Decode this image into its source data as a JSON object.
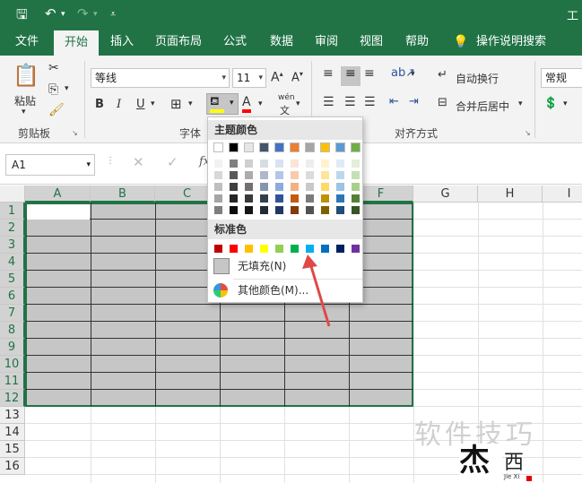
{
  "titlebar": {
    "title": "工"
  },
  "tabs": [
    "文件",
    "开始",
    "插入",
    "页面布局",
    "公式",
    "数据",
    "审阅",
    "视图",
    "帮助",
    "操作说明搜索"
  ],
  "ribbon": {
    "paste_label": "粘贴",
    "clipboard_group": "剪贴板",
    "font_name": "等线",
    "font_size": "11",
    "font_group": "字体",
    "bold": "B",
    "italic": "I",
    "underline": "U",
    "wen": "wén",
    "wrap_text": "自动换行",
    "merge_center": "合并后居中",
    "align_group": "对齐方式",
    "number_format": "常规"
  },
  "formula_bar": {
    "name_box": "A1",
    "fx": "fx"
  },
  "grid": {
    "columns": [
      "A",
      "B",
      "C",
      "D",
      "E",
      "F",
      "G",
      "H",
      "I"
    ],
    "rows": [
      "1",
      "2",
      "3",
      "4",
      "5",
      "6",
      "7",
      "8",
      "9",
      "10",
      "11",
      "12",
      "13",
      "14",
      "15",
      "16"
    ]
  },
  "dropdown": {
    "theme_colors_label": "主题颜色",
    "standard_colors_label": "标准色",
    "no_fill": "无填充(N)",
    "more_colors": "其他颜色(M)...",
    "theme_top": [
      "#ffffff",
      "#000000",
      "#e7e6e6",
      "#44546a",
      "#4472c4",
      "#ed7d31",
      "#a5a5a5",
      "#ffc000",
      "#5b9bd5",
      "#70ad47"
    ],
    "theme_shades": [
      [
        "#f2f2f2",
        "#7f7f7f",
        "#d0cece",
        "#d6dce4",
        "#d9e2f3",
        "#fbe5d5",
        "#ededed",
        "#fff2cc",
        "#deebf6",
        "#e2efd9"
      ],
      [
        "#d8d8d8",
        "#595959",
        "#aeabab",
        "#adb9ca",
        "#b4c6e7",
        "#f7cbac",
        "#dbdbdb",
        "#fee599",
        "#bdd7ee",
        "#c5e0b3"
      ],
      [
        "#bfbfbf",
        "#3f3f3f",
        "#757070",
        "#8496b0",
        "#8eaadb",
        "#f4b183",
        "#c9c9c9",
        "#ffd965",
        "#9dc3e6",
        "#a8d08d"
      ],
      [
        "#a5a5a5",
        "#262626",
        "#3a3838",
        "#323f4f",
        "#2f5496",
        "#c55a11",
        "#7b7b7b",
        "#bf9000",
        "#2e75b5",
        "#538135"
      ],
      [
        "#7f7f7f",
        "#0c0c0c",
        "#171616",
        "#222a35",
        "#1f3864",
        "#833c0b",
        "#525252",
        "#7f6000",
        "#1e4e79",
        "#375623"
      ]
    ],
    "standard": [
      "#c00000",
      "#ff0000",
      "#ffc000",
      "#ffff00",
      "#92d050",
      "#00b050",
      "#00b0f0",
      "#0070c0",
      "#002060",
      "#7030a0"
    ]
  },
  "watermark": {
    "text": "软件技巧",
    "logo_text": "西",
    "logo_sub": "Jie Xi"
  },
  "colors": {
    "excel_green": "#217346",
    "arrow": "#e04848"
  }
}
